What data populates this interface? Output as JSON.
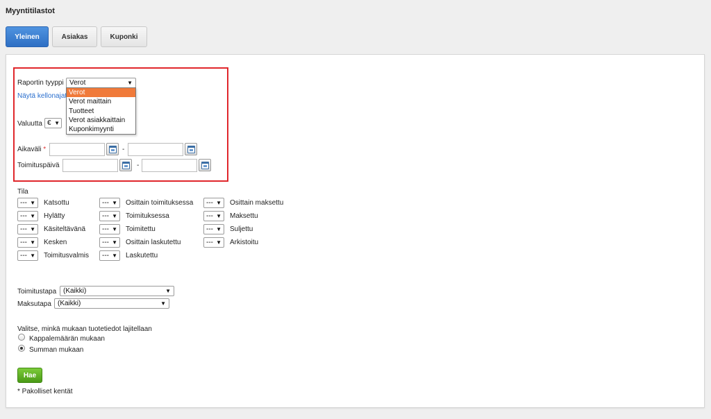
{
  "page": {
    "title": "Myyntitilastot"
  },
  "tabs": [
    {
      "label": "Yleinen",
      "active": true
    },
    {
      "label": "Asiakas",
      "active": false
    },
    {
      "label": "Kuponki",
      "active": false
    }
  ],
  "report": {
    "type_label": "Raportin tyyppi",
    "selected": "Verot",
    "options": [
      "Verot",
      "Verot maittain",
      "Tuotteet",
      "Verot asiakkaittain",
      "Kuponkimyynti"
    ],
    "show_hours_link": "Näytä kellonajat"
  },
  "currency": {
    "label": "Valuutta",
    "value": "€"
  },
  "period": {
    "label": "Aikaväli",
    "required_mark": "*",
    "separator": "-"
  },
  "delivery_date": {
    "label": "Toimituspäivä",
    "separator": "-"
  },
  "status": {
    "heading": "Tila",
    "select_value": "---",
    "columns": [
      [
        "Katsottu",
        "Hylätty",
        "Käsiteltävänä",
        "Kesken",
        "Toimitusvalmis"
      ],
      [
        "Osittain toimituksessa",
        "Toimituksessa",
        "Toimitettu",
        "Osittain laskutettu",
        "Laskutettu"
      ],
      [
        "Osittain maksettu",
        "Maksettu",
        "Suljettu",
        "Arkistoitu"
      ]
    ]
  },
  "delivery_method": {
    "label": "Toimitustapa",
    "value": "(Kaikki)"
  },
  "payment_method": {
    "label": "Maksutapa",
    "value": "(Kaikki)"
  },
  "sort": {
    "heading": "Valitse, minkä mukaan tuotetiedot lajitellaan",
    "options": [
      {
        "label": "Kappalemäärän mukaan",
        "checked": false
      },
      {
        "label": "Summan mukaan",
        "checked": true
      }
    ]
  },
  "submit": {
    "label": "Hae"
  },
  "footnote": "* Pakolliset kentät"
}
